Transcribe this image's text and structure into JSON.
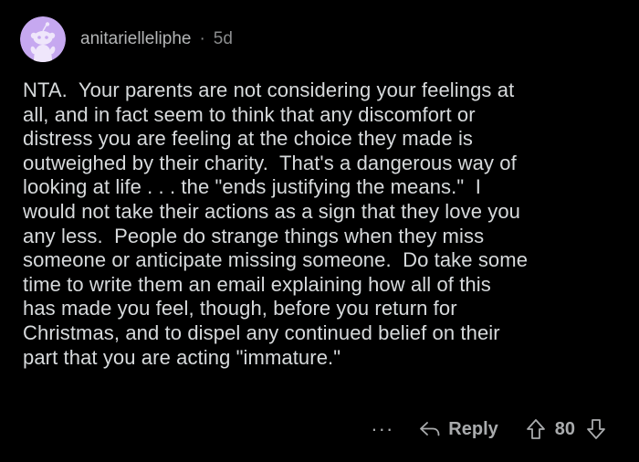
{
  "comment": {
    "username": "anitarielleliphe",
    "separator": "·",
    "age": "5d",
    "body": "NTA.  Your parents are not considering your feelings at\nall, and in fact seem to think that any discomfort or\ndistress you are feeling at the choice they made is\noutweighed by their charity.  That's a dangerous way of\nlooking at life . . . the \"ends justifying the means.\"  I\nwould not take their actions as a sign that they love you\nany less.  People do strange things when they miss\nsomeone or anticipate missing someone.  Do take some\ntime to write them an email explaining how all of this\nhas made you feel, though, before you return for\nChristmas, and to dispel any continued belief on their\npart that you are acting \"immature.\"",
    "more_label": "···",
    "reply_label": "Reply",
    "score": "80",
    "avatar_icon": "snoo-avatar-icon",
    "avatar_color": "#c6a8f0"
  }
}
